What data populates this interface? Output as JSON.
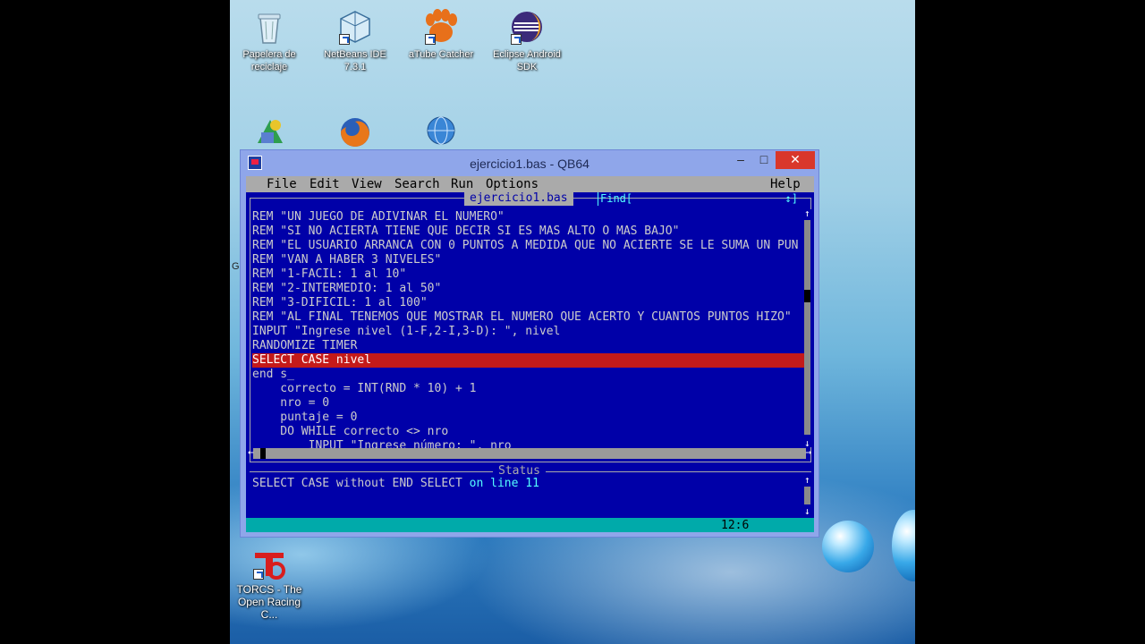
{
  "desktop": {
    "icons_top": [
      {
        "label": "Papelera de reciclaje",
        "icon": "recycle-bin-icon"
      },
      {
        "label": "NetBeans IDE 7.3.1",
        "icon": "netbeans-icon"
      },
      {
        "label": "aTube Catcher",
        "icon": "atube-catcher-icon"
      },
      {
        "label": "Eclipse Android SDK",
        "icon": "eclipse-icon"
      }
    ],
    "icons_row2": [
      "app-icon",
      "firefox-icon",
      "network-globe-icon"
    ],
    "torcs_label": "TORCS - The Open Racing C...",
    "stray_char": "G"
  },
  "window": {
    "title": "ejercicio1.bas - QB64",
    "close_glyph": "✕",
    "min_glyph": "–",
    "max_glyph": "□"
  },
  "menu": {
    "items": [
      "File",
      "Edit",
      "View",
      "Search",
      "Run",
      "Options"
    ],
    "help": "Help"
  },
  "editor": {
    "tab_label": "ejercicio1.bas",
    "find_label": "Find[",
    "find_arrows": "↕]",
    "lines": [
      "REM \"UN JUEGO DE ADIVINAR EL NUMERO\"",
      "REM \"SI NO ACIERTA TIENE QUE DECIR SI ES MAS ALTO O MAS BAJO\"",
      "REM \"EL USUARIO ARRANCA CON 0 PUNTOS A MEDIDA QUE NO ACIERTE SE LE SUMA UN PUN",
      "REM \"VAN A HABER 3 NIVELES\"",
      "REM \"1-FACIL: 1 al 10\"",
      "REM \"2-INTERMEDIO: 1 al 50\"",
      "REM \"3-DIFICIL: 1 al 100\"",
      "REM \"AL FINAL TENEMOS QUE MOSTRAR EL NUMERO QUE ACERTO Y CUANTOS PUNTOS HIZO\"",
      "INPUT \"Ingrese nivel (1-F,2-I,3-D): \", nivel",
      "RANDOMIZE TIMER",
      "SELECT CASE nivel",
      "end s_",
      "    correcto = INT(RND * 10) + 1",
      "    nro = 0",
      "    puntaje = 0",
      "    DO WHILE correcto <> nro",
      "        INPUT \"Ingrese número: \", nro"
    ],
    "highlight_index": 10
  },
  "status": {
    "label": "Status",
    "message_prefix": "SELECT CASE without END SELECT ",
    "message_suffix": "on line 11"
  },
  "statusbar": {
    "cursor_position": "12:6"
  },
  "colors": {
    "qb_blue": "#0000a8",
    "highlight_red": "#c41a1a",
    "cyan_bar": "#00aaaa"
  }
}
